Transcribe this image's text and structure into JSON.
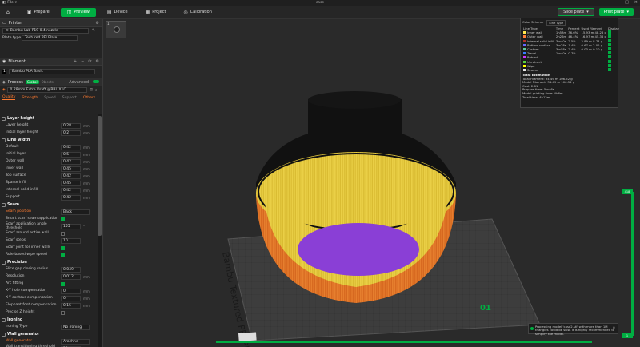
{
  "titlebar": {
    "title": "case",
    "menu": [
      "File",
      "▾"
    ]
  },
  "toolbar": {
    "tabs": [
      {
        "label": "Prepare",
        "active": false
      },
      {
        "label": "Preview",
        "active": true
      },
      {
        "label": "Device",
        "active": false
      },
      {
        "label": "Project",
        "active": false
      },
      {
        "label": "Calibration",
        "active": false
      }
    ],
    "slice_label": "Slice plate",
    "print_label": "Print plate"
  },
  "printer": {
    "section": "Printer",
    "model": "Bambu Lab P1S 0.4 nozzle",
    "plate_label": "Plate type",
    "plate_value": "Textured PEI Plate"
  },
  "filament": {
    "section": "Filament",
    "items": [
      {
        "index": "1",
        "name": "Bambu PLA Basic"
      }
    ]
  },
  "process": {
    "section": "Process",
    "global": "Global",
    "objects": "Objects",
    "advanced": "Advanced",
    "preset": "0.28mm Extra Draft @BBL X1C",
    "tabs": [
      "Quality",
      "Strength",
      "Speed",
      "Support",
      "Others"
    ]
  },
  "params": [
    {
      "type": "group",
      "label": "Layer height"
    },
    {
      "type": "num",
      "label": "Layer height",
      "value": "0.28",
      "unit": "mm"
    },
    {
      "type": "num",
      "label": "Initial layer height",
      "value": "0.2",
      "unit": "mm"
    },
    {
      "type": "group",
      "label": "Line width"
    },
    {
      "type": "num",
      "label": "Default",
      "value": "0.42",
      "unit": "mm"
    },
    {
      "type": "num",
      "label": "Initial layer",
      "value": "0.5",
      "unit": "mm"
    },
    {
      "type": "num",
      "label": "Outer wall",
      "value": "0.42",
      "unit": "mm"
    },
    {
      "type": "num",
      "label": "Inner wall",
      "value": "0.45",
      "unit": "mm"
    },
    {
      "type": "num",
      "label": "Top surface",
      "value": "0.42",
      "unit": "mm"
    },
    {
      "type": "num",
      "label": "Sparse infill",
      "value": "0.45",
      "unit": "mm"
    },
    {
      "type": "num",
      "label": "Internal solid infill",
      "value": "0.42",
      "unit": "mm"
    },
    {
      "type": "num",
      "label": "Support",
      "value": "0.42",
      "unit": "mm"
    },
    {
      "type": "group",
      "label": "Seam"
    },
    {
      "type": "combo",
      "label": "Seam position",
      "value": "Back",
      "orange": true
    },
    {
      "type": "check",
      "label": "Smart scarf seam application",
      "on": true
    },
    {
      "type": "num",
      "label": "Scarf application angle threshold",
      "value": "155",
      "unit": "°"
    },
    {
      "type": "check",
      "label": "Scarf around entire wall",
      "on": false
    },
    {
      "type": "num",
      "label": "Scarf steps",
      "value": "10",
      "unit": ""
    },
    {
      "type": "check",
      "label": "Scarf joint for inner walls",
      "on": true
    },
    {
      "type": "check",
      "label": "Role-based wipe speed",
      "on": true
    },
    {
      "type": "group",
      "label": "Precision"
    },
    {
      "type": "num",
      "label": "Slice gap closing radius",
      "value": "0.049",
      "unit": ""
    },
    {
      "type": "num",
      "label": "Resolution",
      "value": "0.012",
      "unit": "mm"
    },
    {
      "type": "check",
      "label": "Arc fitting",
      "on": true
    },
    {
      "type": "num",
      "label": "X-Y hole compensation",
      "value": "0",
      "unit": "mm"
    },
    {
      "type": "num",
      "label": "X-Y contour compensation",
      "value": "0",
      "unit": "mm"
    },
    {
      "type": "num",
      "label": "Elephant foot compensation",
      "value": "0.15",
      "unit": "mm"
    },
    {
      "type": "check",
      "label": "Precise Z height",
      "on": false
    },
    {
      "type": "group",
      "label": "Ironing"
    },
    {
      "type": "combo",
      "label": "Ironing Type",
      "value": "No ironing",
      "orange": false
    },
    {
      "type": "group",
      "label": "Wall generator"
    },
    {
      "type": "combo",
      "label": "Wall generator",
      "value": "Arachne",
      "orange": true
    },
    {
      "type": "num",
      "label": "Wall transitioning threshold angle",
      "value": "10",
      "unit": "°"
    },
    {
      "type": "num",
      "label": "Wall transitioning filter",
      "value": "",
      "unit": ""
    }
  ],
  "legend": {
    "scheme_label": "Color Scheme",
    "scheme_value": "Line Type",
    "headers": [
      "Line Type",
      "Time",
      "Percent",
      "Used filament",
      "Display"
    ],
    "rows": [
      {
        "name": "Inner wall",
        "color": "#ffe64d",
        "time": "1h53m",
        "pct": "36.6%",
        "used": "15.93 m  48.28 g"
      },
      {
        "name": "Outer wall",
        "color": "#ff7d38",
        "time": "2h26m",
        "pct": "46.4%",
        "used": "16.97 m  45.36 g"
      },
      {
        "name": "Internal solid infill",
        "color": "#b03029",
        "time": "3m40s",
        "pct": "2.5%",
        "used": "2.89 m  8.74 g"
      },
      {
        "name": "Bottom surface",
        "color": "#66f",
        "time": "3m28s",
        "pct": "1.4%",
        "used": "0.67 m  2.02 g"
      },
      {
        "name": "Custom",
        "color": "#5ec79a",
        "time": "3m58s",
        "pct": "2.4%",
        "used": "0.03 m  0.10 g"
      },
      {
        "name": "Travel",
        "color": "#387bff",
        "time": "1m40s",
        "pct": "0.7%",
        "used": ""
      },
      {
        "name": "Retract",
        "color": "#cc35ff",
        "time": "",
        "pct": "",
        "used": ""
      },
      {
        "name": "Unretract",
        "color": "#59d13f",
        "time": "",
        "pct": "",
        "used": ""
      },
      {
        "name": "Wipe",
        "color": "#ffff00",
        "time": "",
        "pct": "",
        "used": ""
      },
      {
        "name": "Seams",
        "color": "#e6e6e6",
        "time": "",
        "pct": "",
        "used": ""
      }
    ],
    "totals_title": "Total Estimation",
    "totals": [
      "Total Filament:   34.49 m   106.52 g",
      "Model Filament:   34.49 m   106.52 g",
      "Cost:   2.61",
      "Prepare time:   5m46s",
      "Model printing time:   4h6m",
      "Total time:   4h12m"
    ]
  },
  "plate_label": "Bambu Textured PEI Plate",
  "plate_number": "01",
  "layer_top": "418",
  "layer_bottom": "1",
  "notice": "Processing model 'case2.stl' with more than 1M triangles could be slow. It is highly recommended to simplify the model."
}
